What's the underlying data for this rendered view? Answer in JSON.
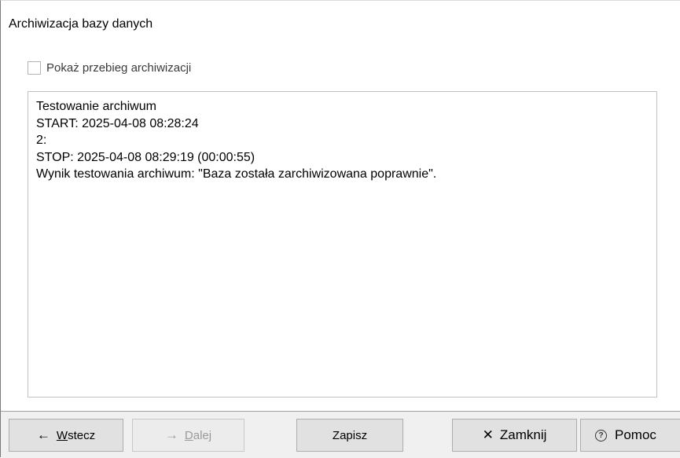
{
  "dialog": {
    "title": "Archiwizacja bazy danych"
  },
  "options": {
    "show_progress_label": "Pokaż przebieg archiwizacji",
    "show_progress_checked": false
  },
  "log": {
    "lines": [
      "Testowanie archiwum",
      "START: 2025-04-08 08:28:24",
      "2:",
      "STOP: 2025-04-08 08:29:19 (00:00:55)",
      "Wynik testowania archiwum: \"Baza została zarchiwizowana poprawnie\"."
    ]
  },
  "footer": {
    "back_label": "Wstecz",
    "back_icon": "arrow-left-icon",
    "next_label": "Dalej",
    "next_icon": "arrow-right-icon",
    "save_label": "Zapisz",
    "close_label": "Zamknij",
    "close_icon": "close-icon",
    "help_label": "Pomoc",
    "help_icon": "help-icon"
  }
}
